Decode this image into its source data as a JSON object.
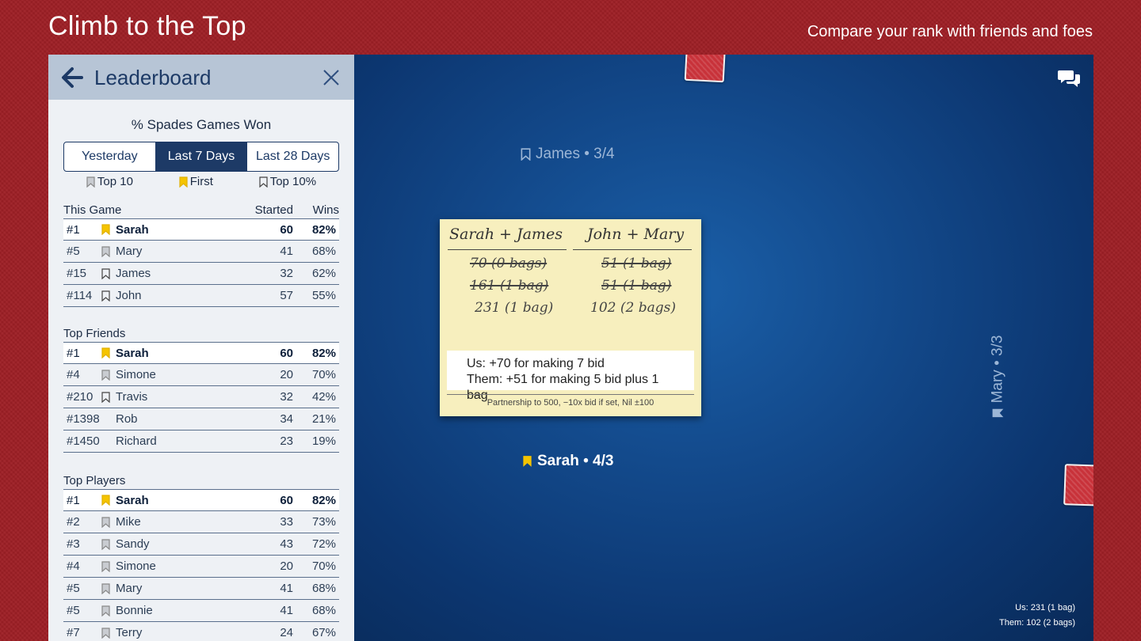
{
  "banner": {
    "title": "Climb to the Top",
    "subtitle": "Compare your rank with friends and foes"
  },
  "panel": {
    "title": "Leaderboard",
    "stat_title": "% Spades Games Won",
    "ranges": [
      "Yesterday",
      "Last 7 Days",
      "Last 28 Days"
    ],
    "active_range": "Last 7 Days",
    "legend": [
      "Top 10",
      "First",
      "Top 10%"
    ],
    "col_started": "Started",
    "col_wins": "Wins",
    "sections": [
      {
        "title": "This Game",
        "rows": [
          {
            "rank": "#1",
            "name": "Sarah",
            "started": "60",
            "wins": "82%",
            "badge": "gold",
            "me": true
          },
          {
            "rank": "#5",
            "name": "Mary",
            "started": "41",
            "wins": "68%",
            "badge": "grey",
            "me": false
          },
          {
            "rank": "#15",
            "name": "James",
            "started": "32",
            "wins": "62%",
            "badge": "outline",
            "me": false
          },
          {
            "rank": "#114",
            "name": "John",
            "started": "57",
            "wins": "55%",
            "badge": "outline",
            "me": false
          }
        ]
      },
      {
        "title": "Top Friends",
        "rows": [
          {
            "rank": "#1",
            "name": "Sarah",
            "started": "60",
            "wins": "82%",
            "badge": "gold",
            "me": true
          },
          {
            "rank": "#4",
            "name": "Simone",
            "started": "20",
            "wins": "70%",
            "badge": "grey",
            "me": false
          },
          {
            "rank": "#210",
            "name": "Travis",
            "started": "32",
            "wins": "42%",
            "badge": "outline",
            "me": false
          },
          {
            "rank": "#1398",
            "name": "Rob",
            "started": "34",
            "wins": "21%",
            "badge": "none",
            "me": false
          },
          {
            "rank": "#1450",
            "name": "Richard",
            "started": "23",
            "wins": "19%",
            "badge": "none",
            "me": false
          }
        ]
      },
      {
        "title": "Top Players",
        "rows": [
          {
            "rank": "#1",
            "name": "Sarah",
            "started": "60",
            "wins": "82%",
            "badge": "gold",
            "me": true
          },
          {
            "rank": "#2",
            "name": "Mike",
            "started": "33",
            "wins": "73%",
            "badge": "grey",
            "me": false
          },
          {
            "rank": "#3",
            "name": "Sandy",
            "started": "43",
            "wins": "72%",
            "badge": "grey",
            "me": false
          },
          {
            "rank": "#4",
            "name": "Simone",
            "started": "20",
            "wins": "70%",
            "badge": "grey",
            "me": false
          },
          {
            "rank": "#5",
            "name": "Mary",
            "started": "41",
            "wins": "68%",
            "badge": "grey",
            "me": false
          },
          {
            "rank": "#5",
            "name": "Bonnie",
            "started": "41",
            "wins": "68%",
            "badge": "grey",
            "me": false
          },
          {
            "rank": "#7",
            "name": "Terry",
            "started": "24",
            "wins": "67%",
            "badge": "grey",
            "me": false
          }
        ]
      }
    ]
  },
  "table": {
    "players": {
      "north": "James • 3/4",
      "south": "Sarah • 4/3",
      "east": "Mary • 3/3"
    },
    "scorecard": {
      "team1": "Sarah + James",
      "team2": "John + Mary",
      "team1_scores": [
        "70 (0 bags)",
        "161 (1 bag)",
        "231 (1 bag)"
      ],
      "team2_scores": [
        "51 (1 bag)",
        "51 (1 bag)",
        "102 (2 bags)"
      ],
      "note_us": "Us: +70 for making 7 bid",
      "note_them": "Them: +51 for making 5 bid plus 1 bag",
      "rules": "Partnership to 500, −10x bid if set, Nil ±100"
    },
    "summary_us": "Us: 231 (1 bag)",
    "summary_them": "Them: 102 (2 bags)"
  },
  "colors": {
    "felt_red": "#9e1f25",
    "table_blue": "#134a8c",
    "gold_badge": "#f5c400",
    "grey_badge": "#9a9a9a",
    "navy": "#1d3a66"
  },
  "icons": [
    "back-arrow-icon",
    "close-icon",
    "chat-icon",
    "bookmark-icon"
  ]
}
